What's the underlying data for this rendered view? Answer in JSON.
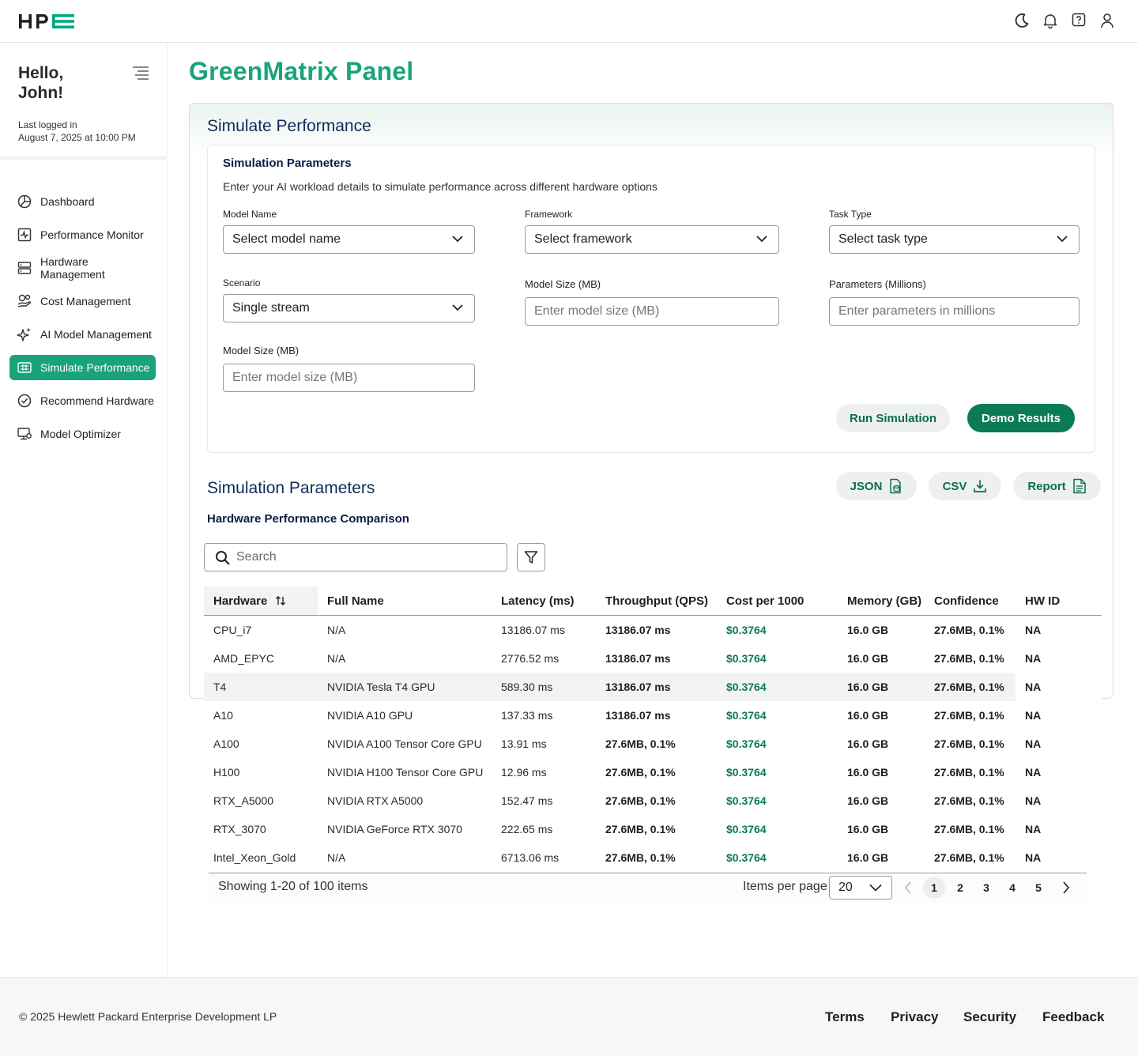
{
  "header": {
    "logo_text": "HPE"
  },
  "sidebar": {
    "greeting": "Hello, John!",
    "last_logged_label": "Last logged in",
    "last_logged_value": "August 7, 2025 at 10:00 PM",
    "items": [
      {
        "label": "Dashboard",
        "icon": "dashboard-icon"
      },
      {
        "label": "Performance Monitor",
        "icon": "performance-icon"
      },
      {
        "label": "Hardware Management",
        "icon": "hardware-icon"
      },
      {
        "label": "Cost Management",
        "icon": "cost-icon"
      },
      {
        "label": "AI Model Management",
        "icon": "sparkle-icon"
      },
      {
        "label": "Simulate Performance",
        "icon": "simulate-icon",
        "active": true
      },
      {
        "label": "Recommend Hardware",
        "icon": "check-circle-icon"
      },
      {
        "label": "Model Optimizer",
        "icon": "optimizer-icon"
      }
    ]
  },
  "main": {
    "page_title": "GreenMatrix Panel",
    "card_title": "Simulate Performance",
    "params": {
      "title": "Simulation Parameters",
      "description": "Enter your AI workload details to simulate performance across different hardware options",
      "model_name_label": "Model Name",
      "model_name_value": "Select model name",
      "framework_label": "Framework",
      "framework_value": "Select framework",
      "task_type_label": "Task Type",
      "task_type_value": "Select task type",
      "scenario_label": "Scenario",
      "scenario_value": "Single stream",
      "model_size_label": "Model Size (MB)",
      "model_size_placeholder": "Enter model size (MB)",
      "parameters_label": "Parameters (Millions)",
      "parameters_placeholder": "Enter parameters in millions",
      "model_size2_label": "Model Size (MB)",
      "model_size2_placeholder": "Enter model size (MB)",
      "run_button": "Run Simulation",
      "demo_button": "Demo Results"
    },
    "results": {
      "title": "Simulation Parameters",
      "subtitle": "Hardware Performance Comparison",
      "json_button": "JSON",
      "csv_button": "CSV",
      "report_button": "Report",
      "search_placeholder": "Search",
      "columns": [
        "Hardware",
        "Full Name",
        "Latency (ms)",
        "Throughput (QPS)",
        "Cost per 1000",
        "Memory (GB)",
        "Confidence",
        "HW ID"
      ],
      "rows": [
        [
          "CPU_i7",
          "N/A",
          "13186.07 ms",
          "13186.07 ms",
          "$0.3764",
          "16.0 GB",
          "27.6MB, 0.1%",
          "NA"
        ],
        [
          "AMD_EPYC",
          "N/A",
          "2776.52 ms",
          "13186.07 ms",
          "$0.3764",
          "16.0 GB",
          "27.6MB, 0.1%",
          "NA"
        ],
        [
          "T4",
          "NVIDIA Tesla T4 GPU",
          "589.30 ms",
          "13186.07 ms",
          "$0.3764",
          "16.0 GB",
          "27.6MB, 0.1%",
          "NA"
        ],
        [
          "A10",
          "NVIDIA A10 GPU",
          "137.33 ms",
          "13186.07 ms",
          "$0.3764",
          "16.0 GB",
          "27.6MB, 0.1%",
          "NA"
        ],
        [
          "A100",
          "NVIDIA A100 Tensor Core GPU",
          "13.91 ms",
          "27.6MB, 0.1%",
          "$0.3764",
          "16.0 GB",
          "27.6MB, 0.1%",
          "NA"
        ],
        [
          "H100",
          "NVIDIA H100 Tensor Core GPU",
          "12.96 ms",
          "27.6MB, 0.1%",
          "$0.3764",
          "16.0 GB",
          "27.6MB, 0.1%",
          "NA"
        ],
        [
          "RTX_A5000",
          "NVIDIA RTX A5000",
          "152.47 ms",
          "27.6MB, 0.1%",
          "$0.3764",
          "16.0 GB",
          "27.6MB, 0.1%",
          "NA"
        ],
        [
          "RTX_3070",
          "NVIDIA GeForce RTX 3070",
          "222.65 ms",
          "27.6MB, 0.1%",
          "$0.3764",
          "16.0 GB",
          "27.6MB, 0.1%",
          "NA"
        ],
        [
          "Intel_Xeon_Gold",
          "N/A",
          "6713.06 ms",
          "27.6MB, 0.1%",
          "$0.3764",
          "16.0 GB",
          "27.6MB, 0.1%",
          "NA"
        ]
      ],
      "showing": "Showing 1-20 of 100 items",
      "items_per_page_label": "Items per page",
      "items_per_page_value": "20",
      "pages": [
        "1",
        "2",
        "3",
        "4",
        "5"
      ],
      "current_page": "1"
    }
  },
  "footer": {
    "copyright": "© 2025 Hewlett Packard Enterprise Development LP",
    "links": [
      "Terms",
      "Privacy",
      "Security",
      "Feedback"
    ]
  },
  "colors": {
    "brand_green": "#1aa37a",
    "button_green": "#0b7a56",
    "title_navy": "#0d2b5c"
  }
}
